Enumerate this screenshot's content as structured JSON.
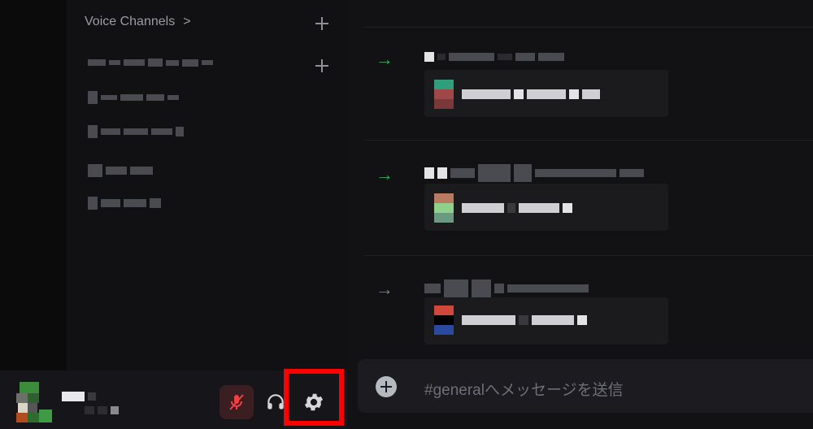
{
  "sidebar": {
    "category_label": "Voice Channels",
    "category_chevron": ">"
  },
  "composer": {
    "placeholder": "#generalへメッセージを送信"
  },
  "user_panel": {
    "mute_state": "muted"
  },
  "colors": {
    "accent_green": "#3ba55c",
    "highlight_red": "#ff0000",
    "muted_red": "#f23f43"
  },
  "icons": [
    "plus-icon",
    "arrow-right-icon",
    "mic-muted-icon",
    "headset-icon",
    "gear-icon",
    "add-circle-icon"
  ]
}
